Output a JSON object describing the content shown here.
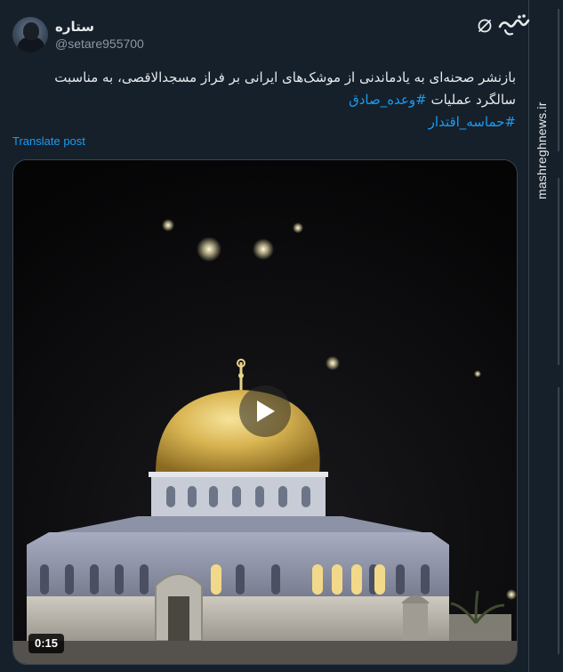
{
  "post": {
    "display_name": "ستاره",
    "handle": "@setare955700",
    "text_main": "بازنشر صحنه‌ای به یادماندنی از موشک‌های ایرانی بر فراز مسجدالاقصی، به مناسبت سالگرد عملیات",
    "hashtag_1": "#وعده_صادق",
    "hashtag_2": "#حماسه_اقتدار",
    "translate_label": "Translate post",
    "video_duration": "0:15"
  },
  "watermark": {
    "logo_text": "مشرق",
    "url": "mashreghnews.ir"
  },
  "icons": {
    "grok": "grok-icon",
    "play": "play-icon"
  },
  "colors": {
    "background": "#15202b",
    "text": "#e7e9ea",
    "secondary_text": "#8b98a5",
    "link": "#1d9bf0",
    "border": "#38444d"
  }
}
